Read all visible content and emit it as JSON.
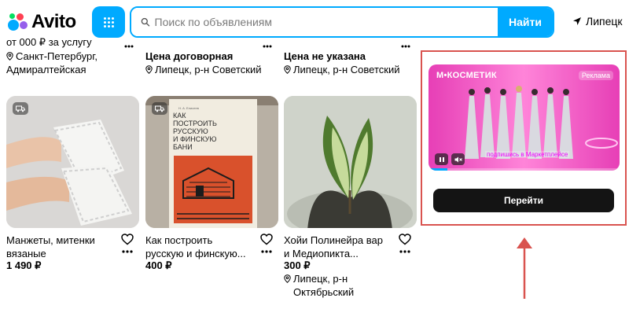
{
  "header": {
    "logo": "Avito",
    "search_placeholder": "Поиск по объявлениям",
    "search_button": "Найти",
    "location": "Липецк"
  },
  "top_row": {
    "cutoff_1": "от 000 ₽ за услугу",
    "item1_location_line1": "Санкт-Петербург,",
    "item1_location_line2": "Адмиралтейская",
    "item2_price": "Цена договорная",
    "item2_location": "Липецк, р-н Советский",
    "item3_price": "Цена не указана",
    "item3_location": "Липецк, р-н Советский"
  },
  "cards": [
    {
      "title_line1": "Манжеты, митенки",
      "title_line2": "вязаные",
      "price": "1 490 ₽"
    },
    {
      "title_line1": "Как построить",
      "title_line2": "русскую и финскую...",
      "price": "400 ₽",
      "book_title": "КАК ПОСТРОИТЬ РУССКУЮ И ФИНСКУЮ БАНИ"
    },
    {
      "title_line1": "Хойи Полинейра вар",
      "title_line2": "и Медиопикта...",
      "price": "300 ₽",
      "location_line1": "Липецк, р-н",
      "location_line2": "Октябрьский"
    }
  ],
  "ad": {
    "brand": "М•КОСМЕТИК",
    "label": "Реклама",
    "caption": "подпишись в Маркетплейсе",
    "cta": "Перейти",
    "progress_percent": 10
  },
  "colors": {
    "accent": "#00aaff",
    "highlight": "#d9534f"
  }
}
